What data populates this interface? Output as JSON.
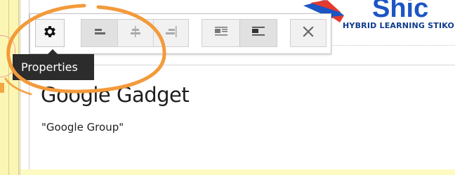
{
  "logo": {
    "subtitle": "HYBRID LEARNING STIKOM",
    "colors": {
      "blue": "#1c55c4",
      "red": "#e43a2f",
      "dark_blue": "#0d3b8c"
    }
  },
  "toolbar": {
    "properties_icon": "gear-icon",
    "align_buttons": [
      {
        "icon": "align-left-icon",
        "active": true
      },
      {
        "icon": "align-center-icon",
        "active": false
      },
      {
        "icon": "align-right-icon",
        "active": false
      }
    ],
    "wrap_buttons": [
      {
        "icon": "wrap-inline-icon",
        "active": false
      },
      {
        "icon": "wrap-left-icon",
        "active": true
      }
    ],
    "remove_icon": "close-icon"
  },
  "tooltip": {
    "text": "Properties"
  },
  "gadget": {
    "title": "Google Gadget",
    "text": "\"Google Group\""
  },
  "annotation": {
    "color": "#f39a3a"
  }
}
